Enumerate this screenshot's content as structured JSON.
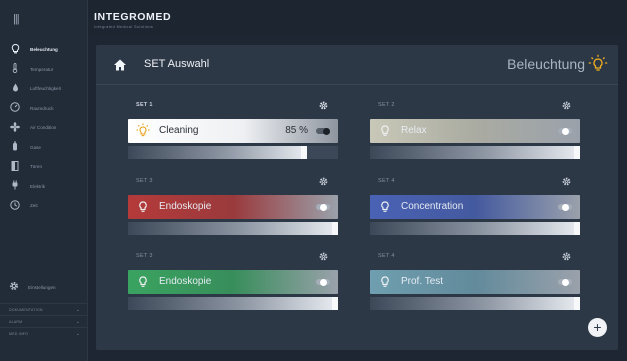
{
  "app": {
    "logo": "INTEGROMED",
    "logo_sub": "Integrated Medical Solutions"
  },
  "sidebar": {
    "menu_icon": "hamburger-icon",
    "items": [
      {
        "label": "Beleuchtung",
        "icon": "bulb-icon",
        "active": true
      },
      {
        "label": "Temperatur",
        "icon": "thermometer-icon"
      },
      {
        "label": "Luftfeuchtigkeit",
        "icon": "droplet-icon"
      },
      {
        "label": "Raumdruck",
        "icon": "gauge-icon"
      },
      {
        "label": "Air Condition",
        "icon": "fan-icon"
      },
      {
        "label": "Gase",
        "icon": "gas-cylinder-icon"
      },
      {
        "label": "Türen",
        "icon": "door-icon"
      },
      {
        "label": "Elektrik",
        "icon": "plug-icon"
      },
      {
        "label": "Zeit",
        "icon": "clock-icon"
      }
    ],
    "settings_label": "Einstellungen",
    "sub_sections": [
      {
        "label": "DOKUMENTATION"
      },
      {
        "label": "ALARM"
      },
      {
        "label": "MED INFO"
      }
    ]
  },
  "panel": {
    "title": "SET Auswahl",
    "mode_title": "Beleuchtung",
    "home_icon": "home-icon",
    "mode_icon": "lightbulb-icon"
  },
  "sets": [
    {
      "label": "SET 1",
      "name": "Cleaning",
      "value": "85 %",
      "on": true,
      "level": 0.85,
      "color": "#e8eaee"
    },
    {
      "label": "SET 2",
      "name": "Relax",
      "on": false,
      "level": 1.0,
      "color": "#c9c8b8"
    },
    {
      "label": "SET 3",
      "name": "Endoskopie",
      "on": false,
      "level": 1.0,
      "color": "#b53a3a"
    },
    {
      "label": "SET 4",
      "name": "Concentration",
      "on": false,
      "level": 1.0,
      "color": "#4a62b5"
    },
    {
      "label": "SET 3",
      "name": "Endoskopie",
      "on": false,
      "level": 1.0,
      "color": "#3aa360"
    },
    {
      "label": "SET 4",
      "name": "Prof. Test",
      "on": false,
      "level": 1.0,
      "color": "#6f9fb0"
    }
  ],
  "fab_label": "+"
}
